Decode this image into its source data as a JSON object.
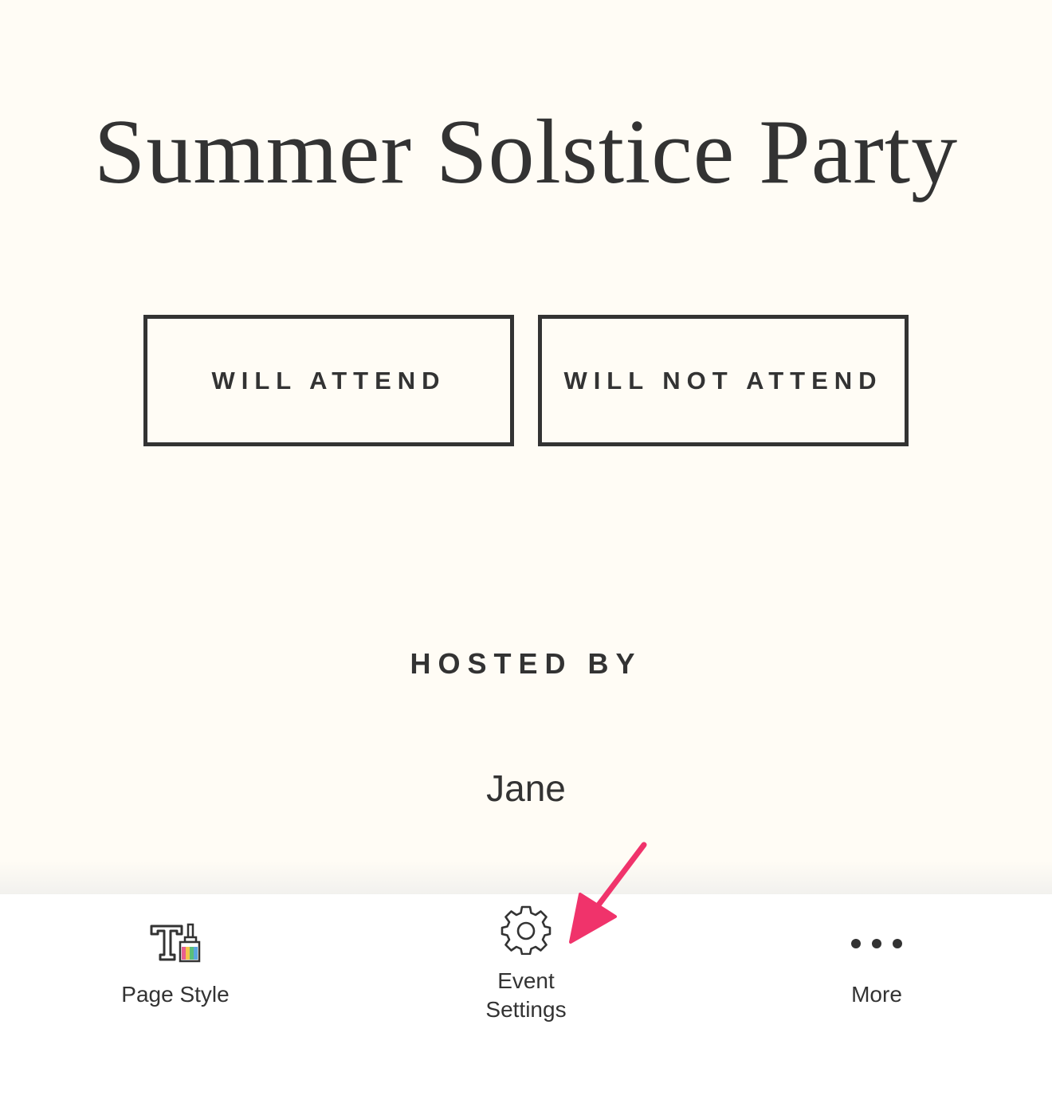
{
  "event": {
    "title": "Summer Solstice Party"
  },
  "rsvp": {
    "attend_label": "WILL ATTEND",
    "not_attend_label": "WILL NOT ATTEND"
  },
  "host": {
    "section_label": "HOSTED BY",
    "name": "Jane"
  },
  "toolbar": {
    "page_style_label": "Page Style",
    "event_settings_label": "Event\nSettings",
    "more_label": "More",
    "icons": {
      "page_style": "typography-brush-icon",
      "event_settings": "gear-icon",
      "more": "more-dots-icon"
    }
  },
  "colors": {
    "page_background": "#fffcf5",
    "text": "#333333",
    "toolbar_background": "#ffffff",
    "annotation_arrow": "#f0336b"
  }
}
